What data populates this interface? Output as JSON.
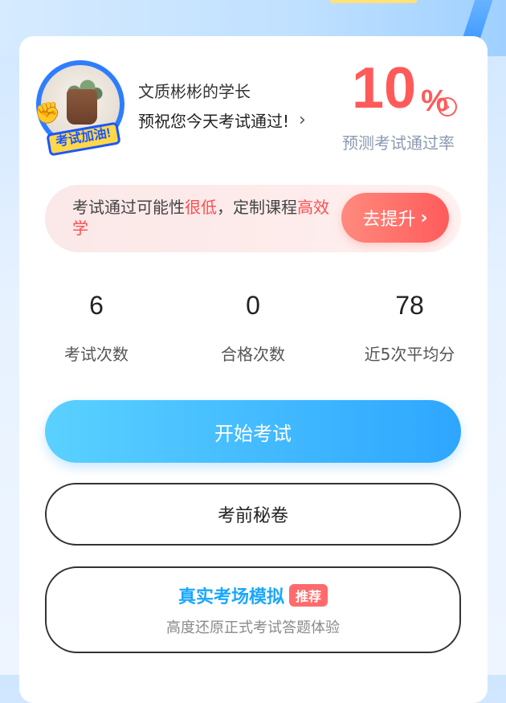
{
  "header": {
    "avatar_badge": "考试加油!",
    "user_name": "文质彬彬的学长",
    "greeting": "预祝您今天考试通过!",
    "pass_rate_value": "10",
    "pass_rate_unit": "%",
    "pass_rate_label": "预测考试通过率"
  },
  "banner": {
    "text_1": "考试通过可能性",
    "text_2": "很低",
    "text_3": "，定制课程",
    "text_4": "高效学",
    "button": "去提升"
  },
  "stats": [
    {
      "value": "6",
      "label": "考试次数"
    },
    {
      "value": "0",
      "label": "合格次数"
    },
    {
      "value": "78",
      "label": "近5次平均分"
    }
  ],
  "actions": {
    "start": "开始考试",
    "secret": "考前秘卷",
    "mock_title": "真实考场模拟",
    "mock_badge": "推荐",
    "mock_sub": "高度还原正式考试答题体验"
  },
  "colors": {
    "accent_red": "#ff5a5a",
    "accent_blue": "#2ea6ff"
  }
}
